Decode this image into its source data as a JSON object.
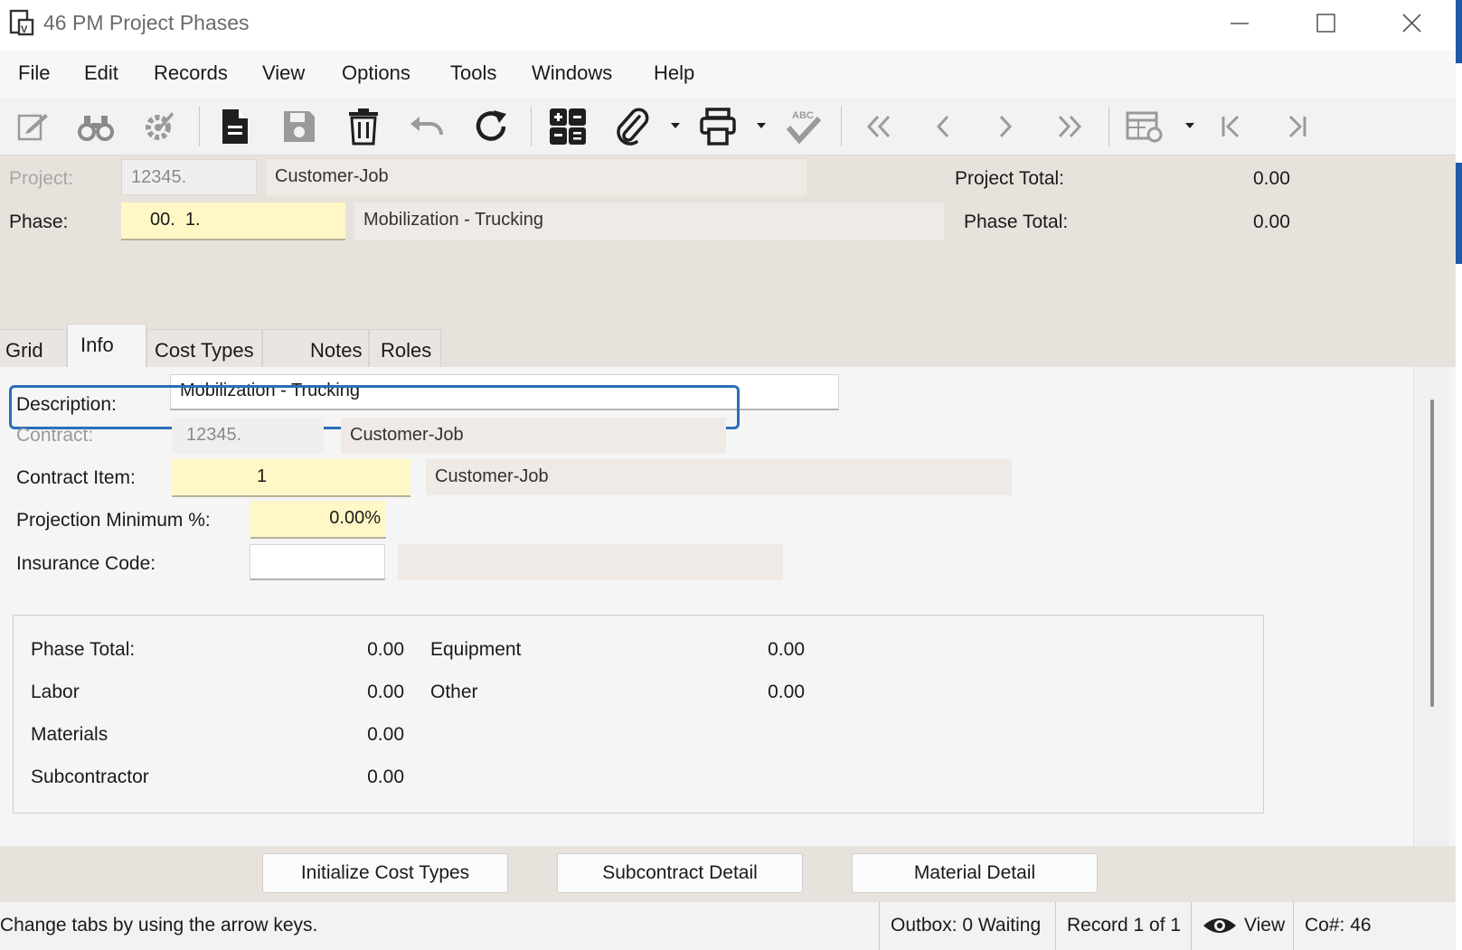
{
  "window": {
    "title": "46 PM Project Phases"
  },
  "menu": [
    "File",
    "Edit",
    "Records",
    "View",
    "Options",
    "Tools",
    "Windows",
    "Help"
  ],
  "toolbar": {
    "icons": [
      "edit-icon",
      "find-icon",
      "settings-icon",
      "new-record-icon",
      "save-icon",
      "delete-icon",
      "undo-icon",
      "refresh-icon",
      "grid-calc-icon",
      "attach-icon",
      "print-icon",
      "spellcheck-icon",
      "first-record-icon",
      "previous-record-icon",
      "next-record-icon",
      "last-record-icon",
      "grid-settings-icon",
      "first-page-icon",
      "last-page-icon"
    ]
  },
  "header": {
    "project_label": "Project:",
    "project_value": "12345.",
    "project_desc": "Customer-Job",
    "project_total_label": "Project Total:",
    "project_total_value": "0.00",
    "phase_label": "Phase:",
    "phase_value": "00.  1.",
    "phase_desc": "Mobilization - Trucking",
    "phase_total_label": "Phase Total:",
    "phase_total_value": "0.00"
  },
  "tabs": [
    {
      "label": "Grid"
    },
    {
      "label": "Info"
    },
    {
      "label": "Cost Types"
    },
    {
      "label": "Notes"
    },
    {
      "label": "Roles"
    }
  ],
  "info": {
    "description_label": "Description:",
    "description_value": "Mobilization - Trucking",
    "contract_label": "Contract:",
    "contract_value": "12345.",
    "contract_desc": "Customer-Job",
    "contract_item_label": "Contract Item:",
    "contract_item_value": "1",
    "contract_item_desc": "Customer-Job",
    "projection_label": "Projection Minimum %:",
    "projection_value": "0.00%",
    "insurance_label": "Insurance Code:",
    "insurance_value": ""
  },
  "totals": {
    "phase_total_label": "Phase Total:",
    "phase_total_value": "0.00",
    "labor_label": "Labor",
    "labor_value": "0.00",
    "materials_label": "Materials",
    "materials_value": "0.00",
    "subcontractor_label": "Subcontractor",
    "subcontractor_value": "0.00",
    "equipment_label": "Equipment",
    "equipment_value": "0.00",
    "other_label": "Other",
    "other_value": "0.00"
  },
  "buttons": {
    "init_cost_types": "Initialize Cost Types",
    "subcontract_detail": "Subcontract Detail",
    "material_detail": "Material Detail"
  },
  "status": {
    "message": "Change tabs by using the arrow keys.",
    "outbox": "Outbox: 0 Waiting",
    "record": "Record 1 of 1",
    "view": "View",
    "company": "Co#: 46"
  }
}
